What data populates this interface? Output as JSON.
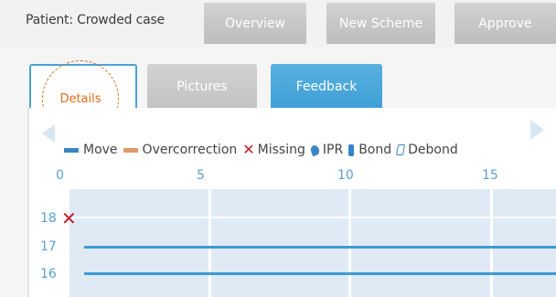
{
  "header": {
    "patient_label": "Patient: Crowded case",
    "buttons": [
      "Overview",
      "New Scheme",
      "Approve"
    ]
  },
  "tabs": [
    "Details",
    "Pictures",
    "Feedback"
  ],
  "legend": {
    "move": "Move",
    "overcorrection": "Overcorrection",
    "missing": "Missing",
    "ipr": "IPR",
    "bond": "Bond",
    "debond": "Debond"
  },
  "axis": {
    "x_ticks": [
      "0",
      "5",
      "10",
      "15"
    ]
  },
  "rows": [
    "18",
    "17",
    "16"
  ],
  "colors": {
    "accent": "#3d9ad2",
    "move": "#3a84c4",
    "overcorrection": "#e09a6a",
    "missing": "#c0202a",
    "highlight": "#e06a1a"
  }
}
